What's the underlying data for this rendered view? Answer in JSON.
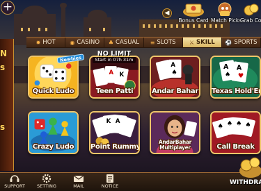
{
  "top_bar": {
    "bonus_card_label": "Bonus Card",
    "match_picks_label": "Match Picks",
    "grab_coins_label": "Grab Coin"
  },
  "left_panel": {
    "line1": "N",
    "line2": "s",
    "line3": "s"
  },
  "tabs": [
    {
      "label": "HOT",
      "icon": "flame-icon",
      "active": false
    },
    {
      "label": "CASINO",
      "icon": "chip-icon",
      "active": false
    },
    {
      "label": "CASUAL",
      "icon": "cards-icon",
      "active": false
    },
    {
      "label": "SLOTS",
      "icon": "slot-icon",
      "active": false
    },
    {
      "label": "SKILL",
      "icon": "skill-icon",
      "active": true
    },
    {
      "label": "SPORTS",
      "icon": "ball-icon",
      "active": false
    }
  ],
  "games": [
    {
      "title": "Quick Ludo",
      "badge": "Newbies"
    },
    {
      "title": "Teen Patti",
      "banner": "NO LIMIT",
      "timer": "Start in 07h 31m"
    },
    {
      "title": "Andar Bahar"
    },
    {
      "title": "Texas Hold'Em"
    },
    {
      "title": "Crazy Ludo"
    },
    {
      "title": "Point Rummy"
    },
    {
      "title_line1": "AndarBahar",
      "title_line2": "Multiplayer"
    },
    {
      "title": "Call Break"
    }
  ],
  "bottom_nav": {
    "support": "SUPPORT",
    "setting": "SETTING",
    "mail": "MAIL",
    "notice": "NOTICE",
    "withdraw": "WITHDRA"
  },
  "colors": {
    "card_border": "#f0c66a",
    "active_tab": "#e8cd86",
    "title_outline": "#4a1f00"
  }
}
